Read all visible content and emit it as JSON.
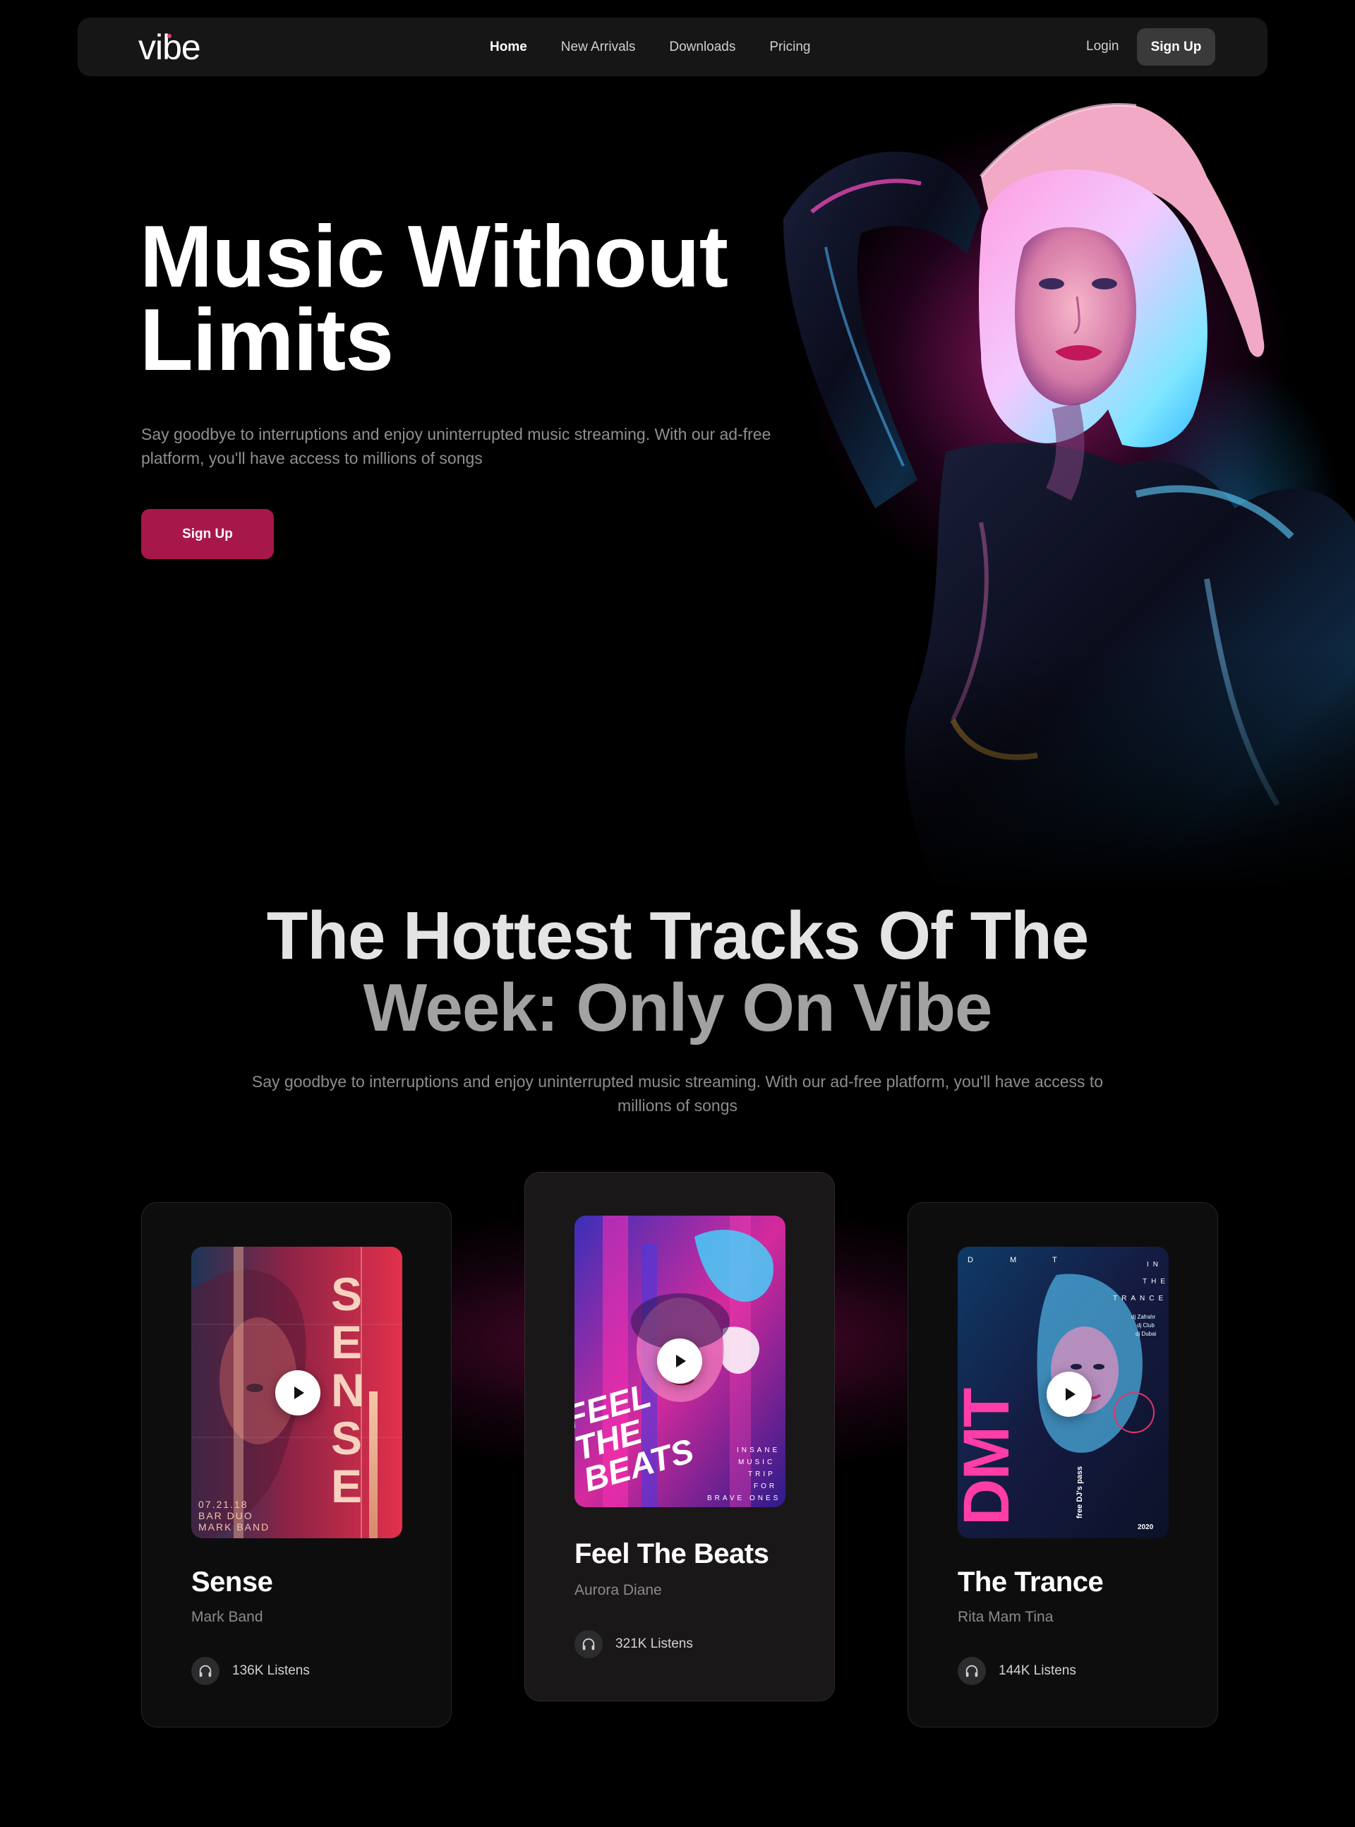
{
  "nav": {
    "logo": "vibe",
    "links": [
      "Home",
      "New Arrivals",
      "Downloads",
      "Pricing"
    ],
    "active_link": "Home",
    "login": "Login",
    "signup": "Sign Up"
  },
  "hero": {
    "title": "Music Without Limits",
    "subtitle": "Say goodbye to interruptions and enjoy uninterrupted music streaming. With our ad-free platform, you'll have access to millions of songs",
    "cta": "Sign Up"
  },
  "tracks_section": {
    "title_line1": "The Hottest Tracks Of The",
    "title_line2": "Week: Only On Vibe",
    "subtitle": "Say goodbye to interruptions and enjoy uninterrupted music streaming. With our ad-free platform, you'll have access to millions of songs"
  },
  "tracks": [
    {
      "title": "Sense",
      "artist": "Mark Band",
      "listens": "136K Listens",
      "cover_word": "SENSE",
      "cover_date": "07.21.18",
      "cover_line2": "BAR DUO",
      "cover_line3": "MARK BAND"
    },
    {
      "title": "Feel The Beats",
      "artist": "Aurora Diane",
      "listens": "321K Listens",
      "cover_word1": "FEEL",
      "cover_word2": "THE",
      "cover_word3": "BEATS",
      "cover_side": [
        "INSANE",
        "MUSIC",
        "TRIP",
        "FOR",
        "BRAVE ONES"
      ]
    },
    {
      "title": "The Trance",
      "artist": "Rita Mam Tina",
      "listens": "144K Listens",
      "cover_word": "DMT",
      "cover_top": [
        "D",
        "M",
        "T"
      ],
      "cover_right": [
        "IN",
        "THE",
        "TRANCE"
      ],
      "cover_djs": [
        "dj Zafrahr",
        "dj Club",
        "dj Dubai"
      ],
      "cover_side": "free DJ's pass",
      "cover_year": "2020"
    }
  ],
  "colors": {
    "accent": "#a7174a",
    "glow_pink": "#ff28aa",
    "glow_blue": "#28aaff",
    "bg": "#000000"
  },
  "icons": {
    "play": "play-icon",
    "listens": "headphones-icon"
  }
}
